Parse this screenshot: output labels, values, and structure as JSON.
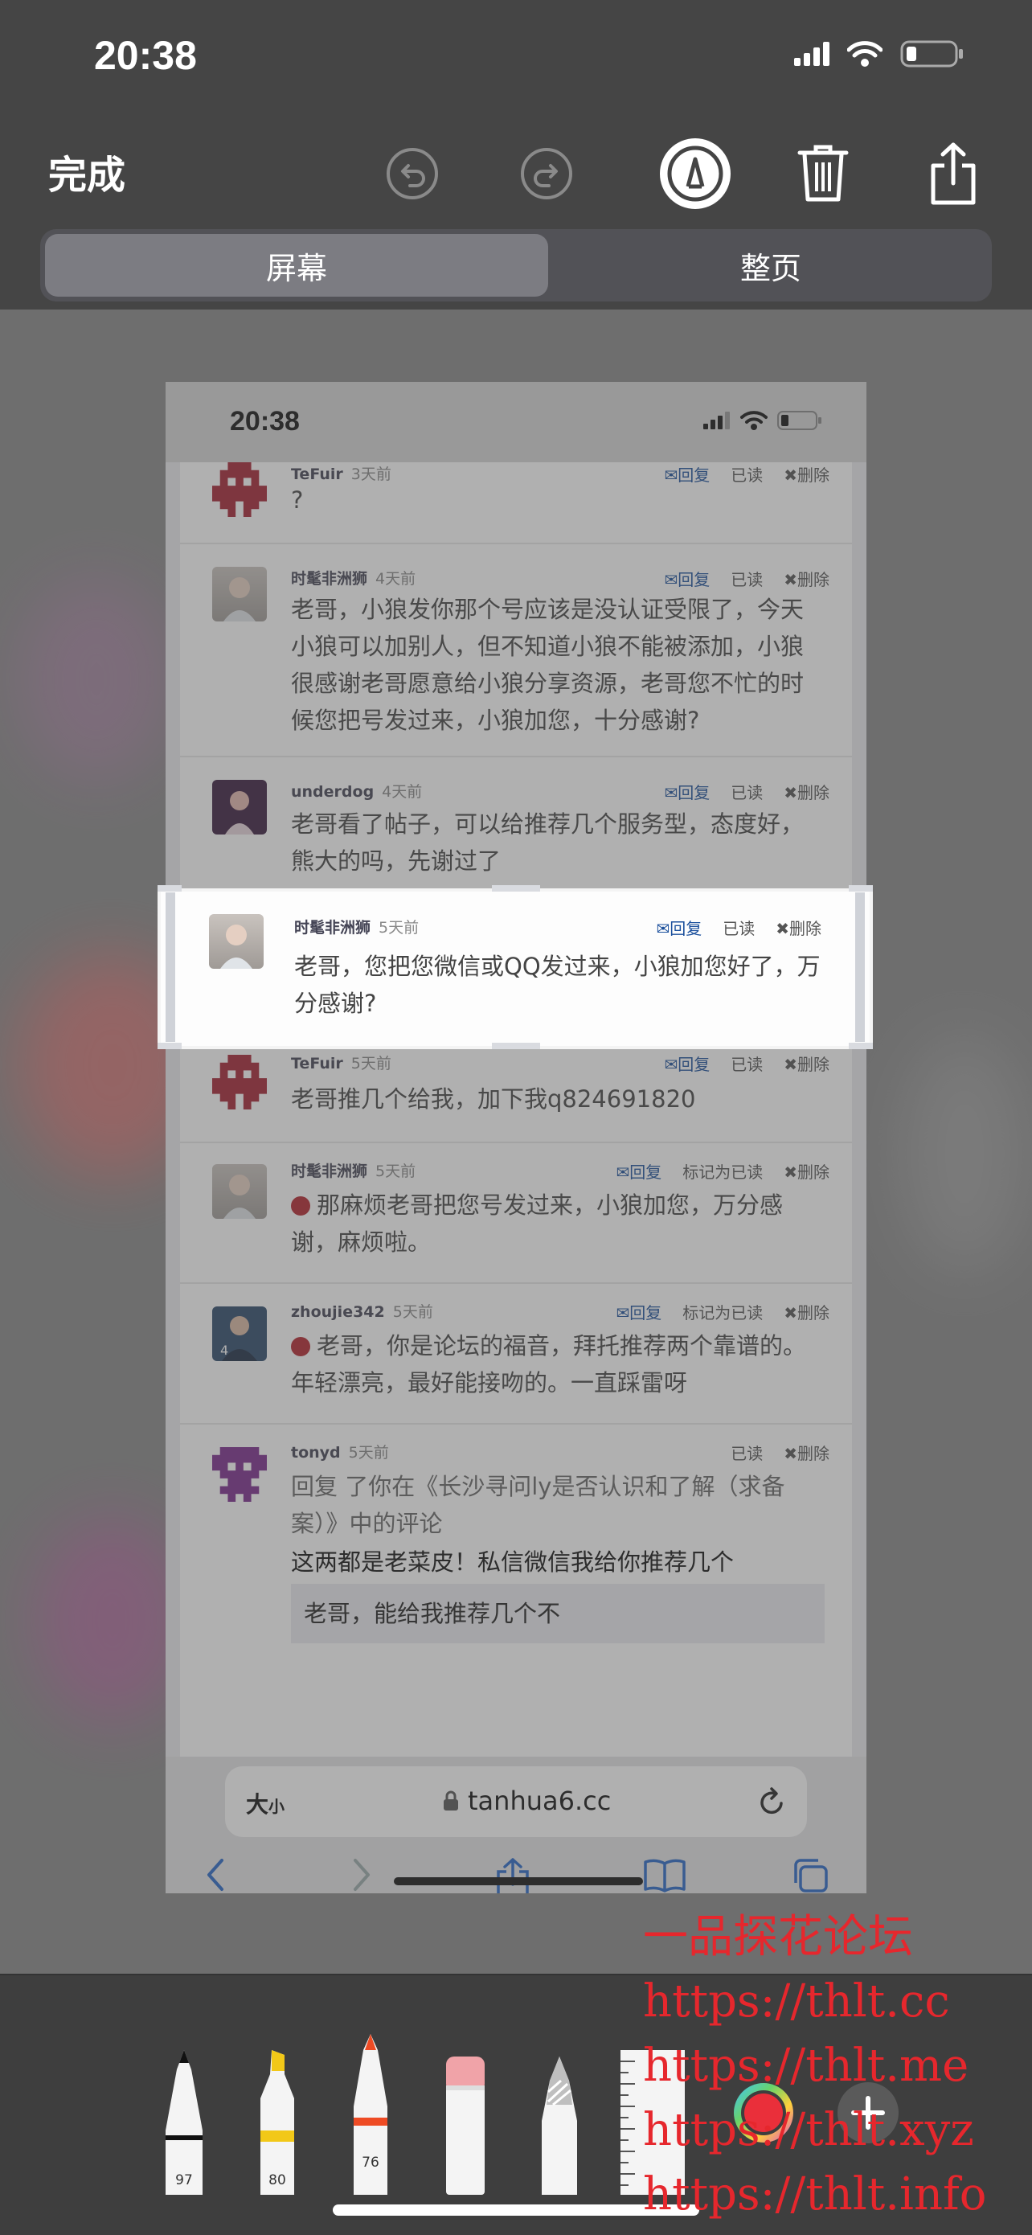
{
  "status_bar": {
    "time": "20:38"
  },
  "toolbar": {
    "done_label": "完成"
  },
  "segments": [
    {
      "label": "屏幕",
      "selected": true
    },
    {
      "label": "整页",
      "selected": false
    }
  ],
  "screenshot": {
    "status_time": "20:38",
    "comments": [
      {
        "user": "TeFuir",
        "ago": "3天前",
        "actions": [
          "回复",
          "已读",
          "删除"
        ],
        "text": "?"
      },
      {
        "user": "时髦非洲狮",
        "ago": "4天前",
        "actions": [
          "回复",
          "已读",
          "删除"
        ],
        "text": "老哥，小狼发你那个号应该是没认证受限了，今天小狼可以加别人，但不知道小狼不能被添加，小狼很感谢老哥愿意给小狼分享资源，老哥您不忙的时候您把号发过来，小狼加您，十分感谢?"
      },
      {
        "user": "underdog",
        "ago": "4天前",
        "actions": [
          "回复",
          "已读",
          "删除"
        ],
        "text": "老哥看了帖子，可以给推荐几个服务型，态度好，熊大的吗，先谢过了"
      },
      {
        "user": "时髦非洲狮",
        "ago": "5天前",
        "actions": [
          "回复",
          "已读",
          "删除"
        ],
        "text": "老哥，您把您微信或QQ发过来，小狼加您好了，万分感谢?"
      },
      {
        "user": "TeFuir",
        "ago": "5天前",
        "actions": [
          "回复",
          "已读",
          "删除"
        ],
        "text": "老哥推几个给我，加下我q824691820"
      },
      {
        "user": "时髦非洲狮",
        "ago": "5天前",
        "actions": [
          "回复",
          "标记为已读",
          "删除"
        ],
        "text": "那麻烦老哥把您号发过来，小狼加您，万分感谢，麻烦啦。"
      },
      {
        "user": "zhoujie342",
        "ago": "5天前",
        "actions": [
          "回复",
          "标记为已读",
          "删除"
        ],
        "text": "老哥，你是论坛的福音，拜托推荐两个靠谱的。年轻漂亮，最好能接吻的。一直踩雷呀"
      },
      {
        "user": "tonyd",
        "ago": "5天前",
        "actions": [
          "已读",
          "删除"
        ],
        "text": "回复 了你在《长沙寻问ly是否认识和了解（求备案）》中的评论",
        "reply": "这两都是老菜皮！私信微信我给你推荐几个",
        "quote": "老哥，能给我推荐几个不"
      }
    ],
    "browser": {
      "text_size_big": "大",
      "text_size_small": "小",
      "url": "tanhua6.cc"
    }
  },
  "tools": [
    {
      "name": "pen",
      "value": "97"
    },
    {
      "name": "highlighter",
      "value": "80"
    },
    {
      "name": "pencil",
      "value": "76"
    },
    {
      "name": "eraser"
    },
    {
      "name": "lasso"
    },
    {
      "name": "ruler"
    }
  ],
  "watermark": {
    "lines": [
      "一品探花论坛",
      "https://thlt.cc",
      "https://thlt.me",
      "https://thlt.xyz",
      "https://thlt.info"
    ]
  },
  "colors": {
    "accent_red": "#e6272d",
    "link_blue": "#1a4f9c",
    "unread_dot": "#b3232d"
  }
}
